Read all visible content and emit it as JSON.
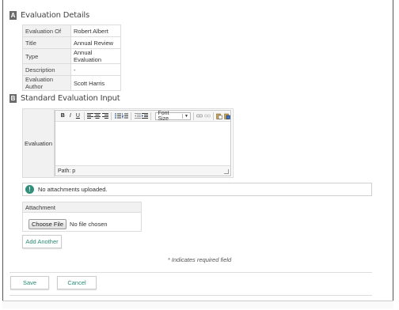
{
  "section_a": {
    "letter": "A",
    "title": "Evaluation Details"
  },
  "details": [
    {
      "label": "Evaluation Of",
      "value": "Robert Albert"
    },
    {
      "label": "Title",
      "value": "Annual Review"
    },
    {
      "label": "Type",
      "value": "Annual Evaluation"
    },
    {
      "label": "Description",
      "value": "-"
    },
    {
      "label": "Evaluation Author",
      "value": "Scott Harris"
    }
  ],
  "section_b": {
    "letter": "B",
    "title": "Standard Evaluation Input"
  },
  "evaluation": {
    "label": "Evaluation",
    "toolbar": {
      "bold": "B",
      "italic": "I",
      "underline": "U",
      "font_size": "Font Size"
    },
    "path_label": "Path: p"
  },
  "notice": {
    "icon": "!",
    "text": "No attachments uploaded."
  },
  "attachment": {
    "label": "Attachment",
    "choose_file": "Choose File",
    "no_file": "No file chosen"
  },
  "add_another_label": "Add Another",
  "required_note": "* Indicates required field",
  "actions": {
    "save_label": "Save",
    "cancel_label": "Cancel"
  },
  "colors": {
    "accent": "#2a8a74",
    "badge": "#6b6b6b"
  }
}
